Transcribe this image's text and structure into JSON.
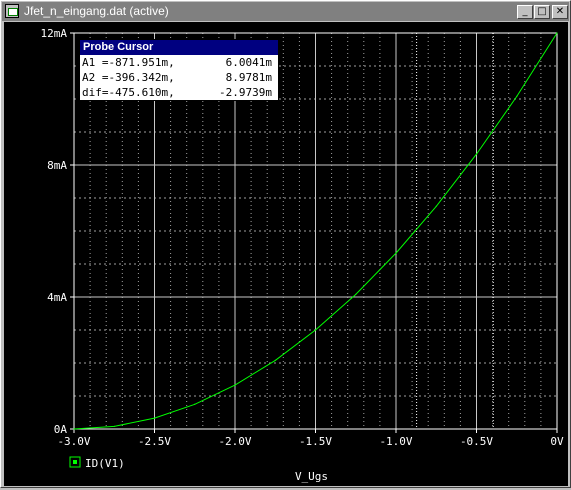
{
  "window": {
    "title": "Jfet_n_eingang.dat (active)",
    "minimize": "_",
    "maximize": "□",
    "close": "✕"
  },
  "probe_cursor": {
    "title": "Probe Cursor",
    "rows": [
      {
        "label": "A1 =-871.951m,",
        "value": "6.0041m"
      },
      {
        "label": "A2 =-396.342m,",
        "value": "8.9781m"
      },
      {
        "label": "dif=-475.610m,",
        "value": "-2.9739m"
      }
    ]
  },
  "chart_data": {
    "type": "line",
    "xlabel": "V_Ugs",
    "ylabel": "",
    "xlim": [
      -3.0,
      0.0
    ],
    "ylim": [
      0,
      12
    ],
    "x_ticks": [
      "-3.0V",
      "-2.5V",
      "-2.0V",
      "-1.5V",
      "-1.0V",
      "-0.5V",
      "0V"
    ],
    "y_ticks": [
      "0A",
      "4mA",
      "8mA",
      "12mA"
    ],
    "grid": true,
    "series": [
      {
        "name": "ID(V1)",
        "color": "#00ff00",
        "x": [
          -3.0,
          -2.75,
          -2.5,
          -2.25,
          -2.0,
          -1.75,
          -1.5,
          -1.25,
          -1.0,
          -0.75,
          -0.5,
          -0.25,
          0.0
        ],
        "y": [
          0.0,
          0.08,
          0.33,
          0.75,
          1.33,
          2.08,
          3.0,
          4.08,
          5.33,
          6.75,
          8.33,
          10.08,
          12.0
        ]
      }
    ],
    "cursors": [
      -0.872,
      -0.396
    ],
    "background": "#000000",
    "axis_color": "#ffffff"
  }
}
